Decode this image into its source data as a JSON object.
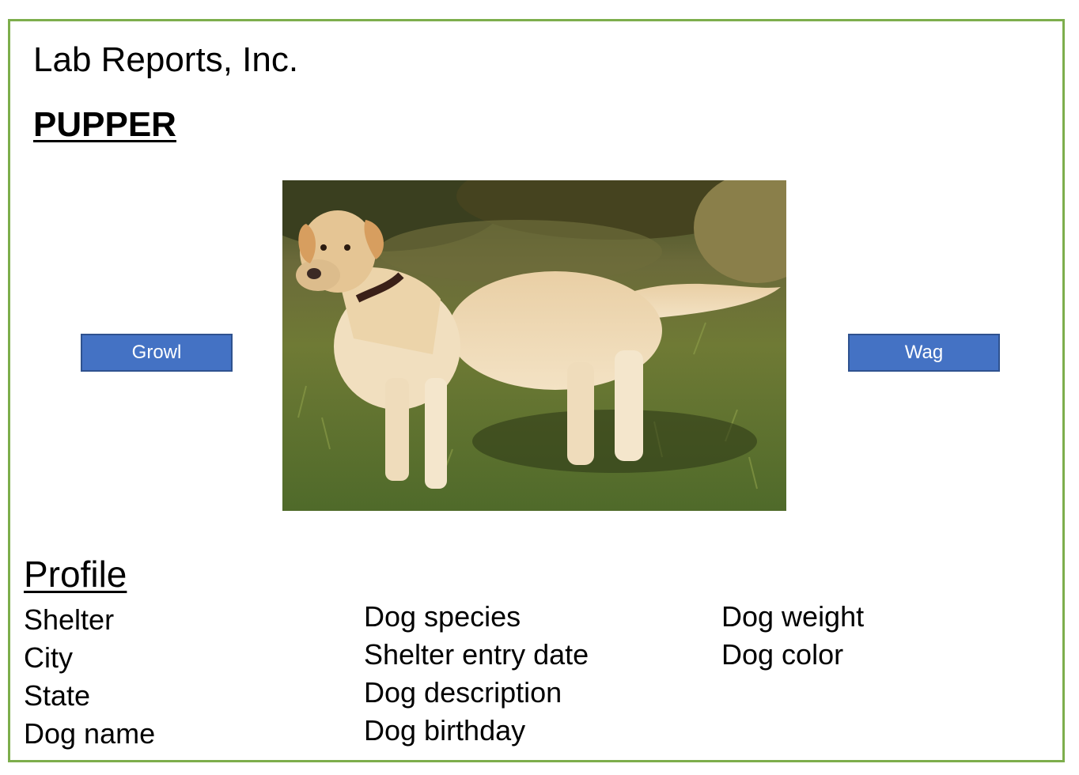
{
  "header": {
    "company": "Lab Reports, Inc.",
    "app_title": "PUPPER"
  },
  "actions": {
    "growl_label": "Growl",
    "wag_label": "Wag"
  },
  "photo": {
    "subject": "yellow labrador retriever standing on grass"
  },
  "profile": {
    "heading": "Profile",
    "columns": [
      [
        "Shelter",
        "City",
        "State",
        "Dog name"
      ],
      [
        "Dog species",
        "Shelter entry date",
        "Dog description",
        "Dog birthday"
      ],
      [
        "Dog weight",
        "Dog color"
      ]
    ]
  },
  "colors": {
    "frame_border": "#7dae4c",
    "button_fill": "#4472c4",
    "button_border": "#2f528f",
    "button_text": "#ffffff"
  }
}
